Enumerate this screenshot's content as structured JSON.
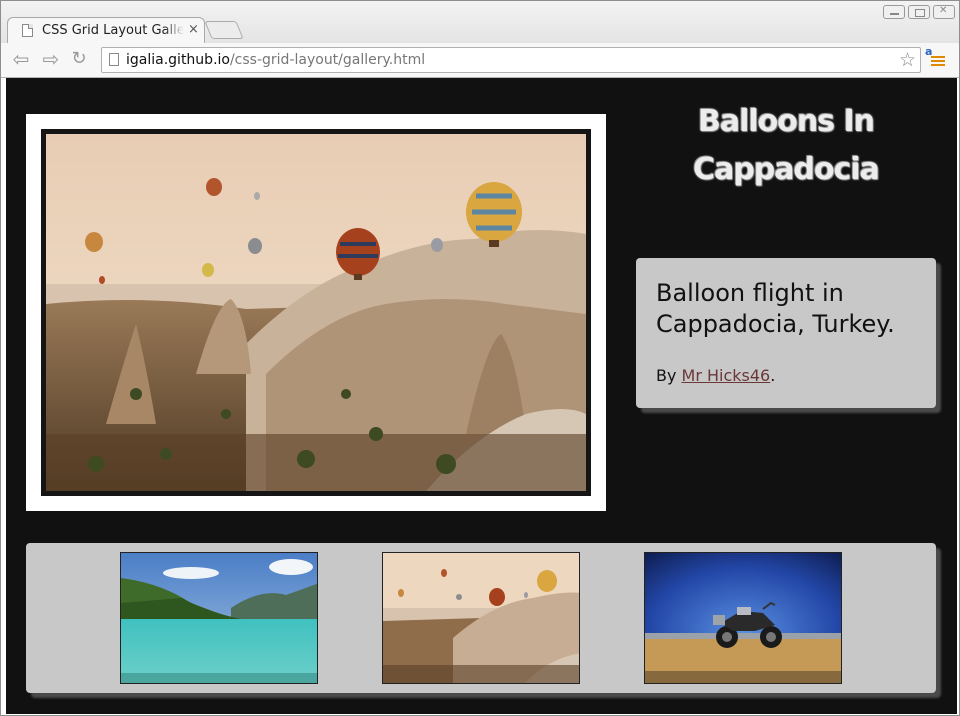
{
  "browser": {
    "tab_title": "CSS Grid Layout Galle",
    "tab_close": "×",
    "url_host": "igalia.github.io",
    "url_path": "/css-grid-layout/gallery.html",
    "extension_label": "a"
  },
  "gallery": {
    "heading_line1": "Balloons In",
    "heading_line2": "Cappadocia",
    "caption": "Balloon flight in Cappadocia, Turkey.",
    "credit_prefix": "By ",
    "credit_author": "Mr Hicks46",
    "credit_suffix": ".",
    "thumbnails": [
      {
        "subject": "turquoise-lake"
      },
      {
        "subject": "cappadocia-balloons"
      },
      {
        "subject": "motorcycle"
      }
    ]
  },
  "colors": {
    "page_background": "#111111",
    "panel_background": "#c8c8c8",
    "link_color": "#6b3838"
  }
}
